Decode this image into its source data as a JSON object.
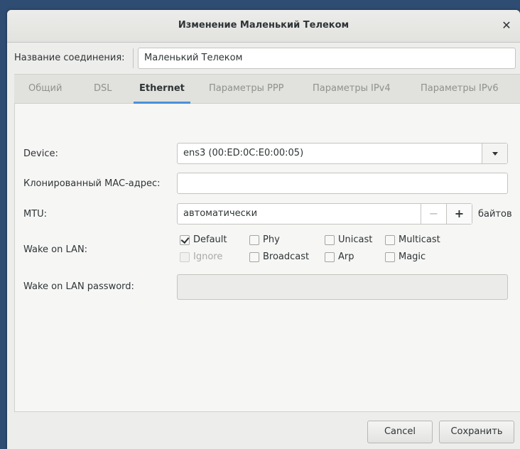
{
  "window": {
    "title": "Изменение Маленький Телеком"
  },
  "connection": {
    "name_label": "Название соединения:",
    "name_value": "Маленький Телеком"
  },
  "tabs": [
    {
      "label": "Общий"
    },
    {
      "label": "DSL"
    },
    {
      "label": "Ethernet"
    },
    {
      "label": "Параметры PPP"
    },
    {
      "label": "Параметры IPv4"
    },
    {
      "label": "Параметры IPv6"
    }
  ],
  "active_tab": "Ethernet",
  "ethernet": {
    "device_label": "Device:",
    "device_value": "ens3 (00:ED:0C:E0:00:05)",
    "cloned_mac_label": "Клонированный MAC-адрес:",
    "cloned_mac_value": "",
    "mtu_label": "MTU:",
    "mtu_value": "автоматически",
    "mtu_unit": "байтов",
    "wol_label": "Wake on LAN:",
    "wol_options": [
      {
        "label": "Default",
        "checked": true,
        "enabled": true
      },
      {
        "label": "Phy",
        "checked": false,
        "enabled": true
      },
      {
        "label": "Unicast",
        "checked": false,
        "enabled": true
      },
      {
        "label": "Multicast",
        "checked": false,
        "enabled": true
      },
      {
        "label": "Ignore",
        "checked": false,
        "enabled": false
      },
      {
        "label": "Broadcast",
        "checked": false,
        "enabled": true
      },
      {
        "label": "Arp",
        "checked": false,
        "enabled": true
      },
      {
        "label": "Magic",
        "checked": false,
        "enabled": true
      }
    ],
    "wol_password_label": "Wake on LAN password:",
    "wol_password_value": ""
  },
  "buttons": {
    "cancel": "Cancel",
    "save": "Сохранить"
  },
  "colors": {
    "accent": "#4a90d9",
    "desktop": "#2f4d73"
  }
}
